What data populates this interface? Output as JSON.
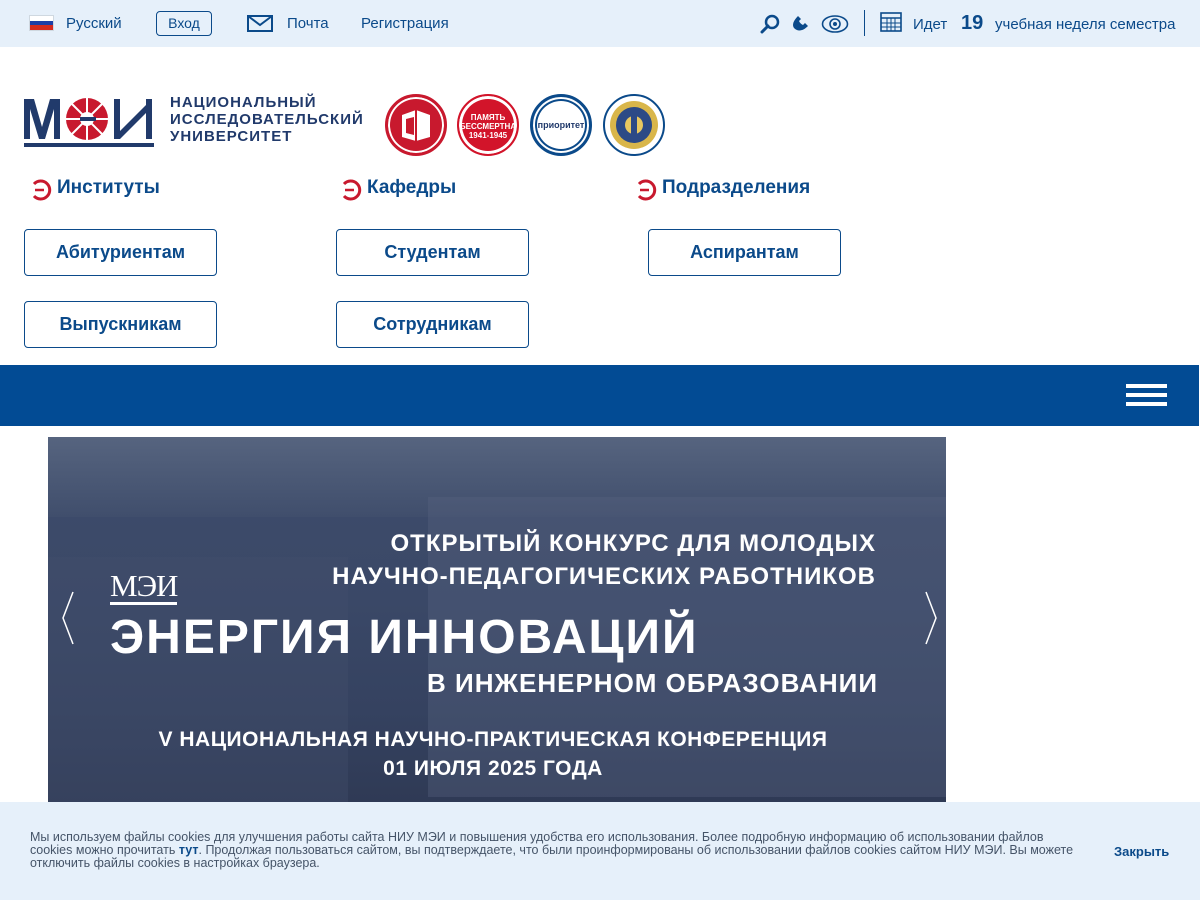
{
  "topbar": {
    "language": "Русский",
    "login": "Вход",
    "mail": "Почта",
    "register": "Регистрация",
    "week_prefix": "Идет",
    "week_number": "19",
    "week_suffix": "учебная неделя семестра"
  },
  "logo": {
    "line1": "НАЦИОНАЛЬНЫЙ",
    "line2": "ИССЛЕДОВАТЕЛЬСКИЙ",
    "line3": "УНИВЕРСИТЕТ"
  },
  "badges": {
    "memory_line1": "ПАМЯТЬ",
    "memory_line2": "БЕССМЕРТНА",
    "memory_line3": "1941-1945",
    "priority": "приоритет"
  },
  "sections": {
    "institutes": "Институты",
    "departments": "Кафедры",
    "divisions": "Подразделения"
  },
  "nav_buttons": {
    "applicants": "Абитуриентам",
    "students": "Студентам",
    "postgrads": "Аспирантам",
    "graduates": "Выпускникам",
    "staff": "Сотрудникам"
  },
  "banner": {
    "line1": "ОТКРЫТЫЙ КОНКУРС ДЛЯ МОЛОДЫХ",
    "line2": "НАУЧНО-ПЕДАГОГИЧЕСКИХ РАБОТНИКОВ",
    "logo": "МЭИ",
    "title": "ЭНЕРГИЯ ИННОВАЦИЙ",
    "subtitle": "В ИНЖЕНЕРНОМ ОБРАЗОВАНИИ",
    "conf_line1": "V НАЦИОНАЛЬНАЯ НАУЧНО-ПРАКТИЧЕСКАЯ КОНФЕРЕНЦИЯ",
    "conf_line2": "01 ИЮЛЯ 2025 ГОДА"
  },
  "cookie": {
    "text_before": "Мы используем файлы cookies для улучшения работы сайта НИУ МЭИ и повышения удобства его использования. Более подробную информацию об использовании файлов cookies можно прочитать ",
    "link": "тут",
    "text_after": ". Продолжая пользоваться сайтом, вы подтверждаете, что были проинформированы об использовании файлов cookies сайтом НИУ МЭИ. Вы можете отключить файлы cookies в настройках браузера.",
    "close": "Закрыть"
  },
  "colors": {
    "brand_blue": "#024b94",
    "brand_red": "#c8192e",
    "topbar_bg": "#e6f0fa"
  },
  "icons": [
    "flag-russia-icon",
    "mail-icon",
    "search-icon",
    "phone-icon",
    "eye-icon",
    "calendar-icon",
    "menu-icon",
    "chevron-left-icon",
    "chevron-right-icon",
    "section-bullet-icon"
  ]
}
